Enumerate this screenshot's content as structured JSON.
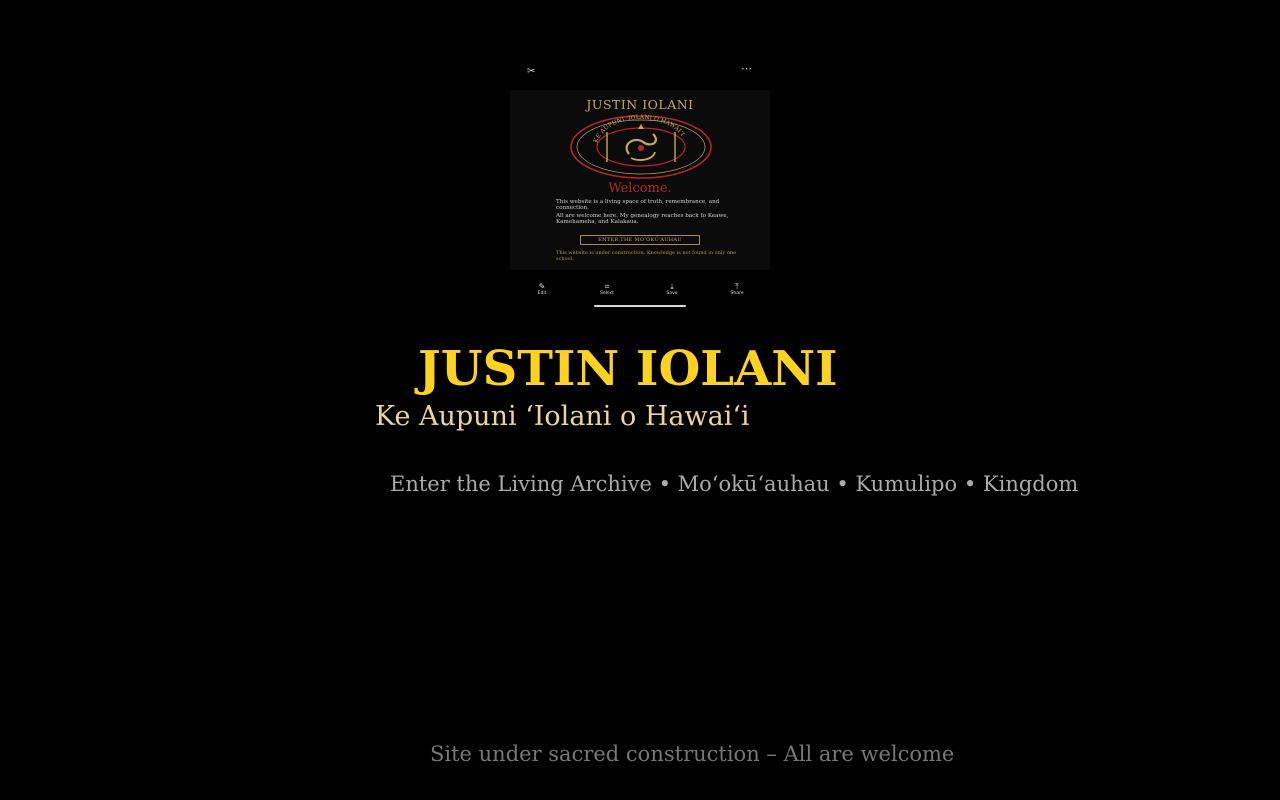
{
  "screenshot": {
    "topbar": {
      "close_icon": "scissors-icon",
      "close_glyph": "✂",
      "more_icon": "more-dots-icon",
      "more_glyph": "⋯"
    },
    "page": {
      "title": "JUSTIN IOLANI",
      "seal_text": "KE AUPUNI ʻIOLANI O HAWAIʻI",
      "welcome": "Welcome.",
      "paragraph_1": "This website is a living space of truth, remembrance, and connection.",
      "paragraph_2": "All are welcome here. My genealogy reaches back to Keawe, Kamehameha, and Kalakaua.",
      "enter_button": "ENTER THE MOʻOKŪʻAUHAU",
      "note": "This website is under construction. Knowledge is not found in only one school.",
      "colors": {
        "title": "#c9a75a",
        "welcome": "#b3262a",
        "seal_ring": "#b3262a",
        "seal_gold": "#c9a75a"
      }
    },
    "toolbar": [
      {
        "label": "Edit",
        "icon": "edit-icon",
        "glyph": "✎"
      },
      {
        "label": "Select",
        "icon": "select-icon",
        "glyph": "⌗"
      },
      {
        "label": "Save",
        "icon": "save-icon",
        "glyph": "⤓"
      },
      {
        "label": "Share",
        "icon": "share-icon",
        "glyph": "⤒"
      }
    ]
  },
  "hero": {
    "title": "JUSTIN IOLANI",
    "subtitle": "Ke Aupuni ʻIolani o Hawaiʻi"
  },
  "nav": {
    "items": [
      {
        "label": "Enter the Living Archive"
      },
      {
        "label": "Moʻokūʻauhau"
      },
      {
        "label": "Kumulipo"
      },
      {
        "label": "Kingdom"
      }
    ],
    "separator": "•"
  },
  "footer": {
    "text": "Site under sacred construction – All are welcome"
  },
  "colors": {
    "background": "#000000",
    "title": "#ffd21f",
    "subtitle": "#ecd59a",
    "nav": "#aaaaaa",
    "footer": "#777777"
  }
}
